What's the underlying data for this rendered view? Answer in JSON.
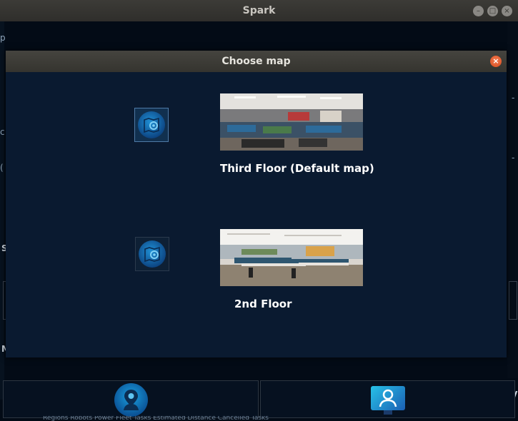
{
  "window": {
    "title": "Spark"
  },
  "dialog": {
    "title": "Choose map",
    "maps": [
      {
        "name": "Third Floor (Default map)",
        "selected": true
      },
      {
        "name": "2nd Floor",
        "selected": false
      }
    ]
  },
  "background": {
    "left_fragments": [
      "p",
      "c",
      "(",
      "S",
      "M"
    ],
    "right_fragments": [
      "-",
      "-",
      "V"
    ],
    "bottom_text": "Regions      Robots Power   Fleet Tasks   Estimated Distance  Cancelled Tasks"
  },
  "bottom_nav": {
    "left_icon": "map-pin-user-icon",
    "right_icon": "user-monitor-icon"
  },
  "colors": {
    "app_bg": "#030b16",
    "dialog_bg": "#0a1a30",
    "titlebar": "#3c3b37",
    "close_button": "#e0582a",
    "accent": "#1a8fd6"
  }
}
